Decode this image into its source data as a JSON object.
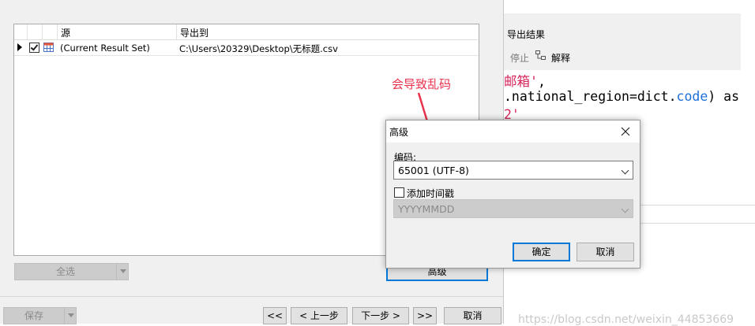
{
  "grid": {
    "col_source": "源",
    "col_export_to": "导出到",
    "rows": [
      {
        "checked": true,
        "source": "(Current Result Set)",
        "path": "C:\\Users\\20329\\Desktop\\无标题.csv"
      }
    ]
  },
  "buttons": {
    "select_all": "全选",
    "advanced": "高级",
    "save": "保存",
    "first": "<<",
    "prev": "< 上一步",
    "next": "下一步 >",
    "last": ">>",
    "cancel_main": "取消"
  },
  "annotation": {
    "text": "会导致乱码",
    "color": "#e8334f"
  },
  "editor": {
    "toolbar_title": "导出结果",
    "stop": "停止",
    "explain": "解释",
    "code_line1_str": "邮箱'",
    "code_line1_rest": ",",
    "code_line2_pre": ".national_region=dict.",
    "code_line2_attr": "code",
    "code_line2_post": ") as",
    "code_line3": "2'"
  },
  "dialog": {
    "title": "高级",
    "encoding_label": "编码:",
    "encoding_value": "65001 (UTF-8)",
    "timestamp_label": "添加时间戳",
    "timestamp_checked": false,
    "timestamp_format": "YYYYMMDD",
    "ok": "确定",
    "cancel": "取消"
  },
  "watermark": "https://blog.csdn.net/weixin_44853669",
  "colors": {
    "accent": "#0078d7",
    "code_string": "#d6245a",
    "code_keyword": "#1e6fd9"
  }
}
